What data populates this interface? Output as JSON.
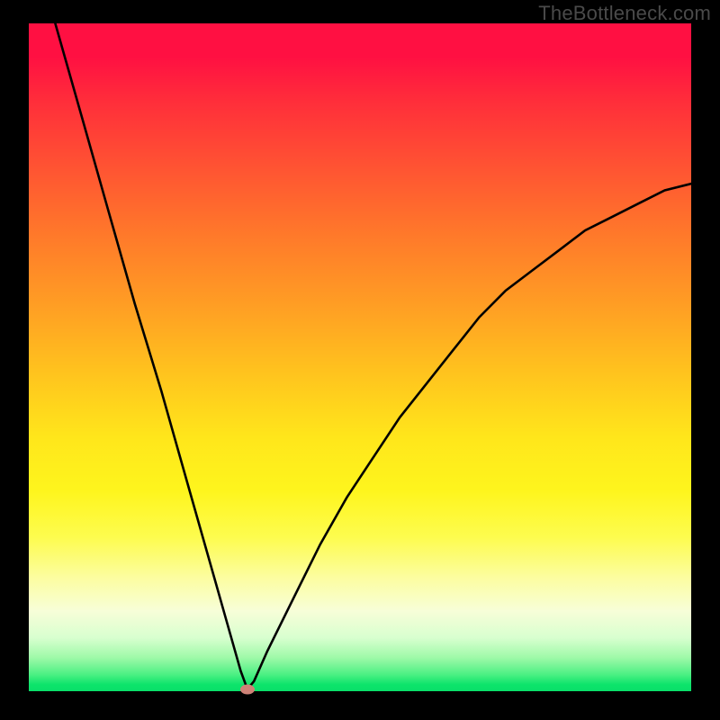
{
  "watermark": "TheBottleneck.com",
  "chart_data": {
    "type": "line",
    "title": "",
    "xlabel": "",
    "ylabel": "",
    "xlim": [
      0,
      100
    ],
    "ylim": [
      0,
      100
    ],
    "grid": false,
    "series": [
      {
        "name": "curve",
        "x": [
          4,
          8,
          12,
          16,
          20,
          24,
          28,
          30,
          32,
          33,
          34,
          36,
          40,
          44,
          48,
          52,
          56,
          60,
          64,
          68,
          72,
          76,
          80,
          84,
          88,
          92,
          96,
          100
        ],
        "y": [
          100,
          86,
          72,
          58,
          45,
          31,
          17,
          10,
          3,
          0.3,
          1.5,
          6,
          14,
          22,
          29,
          35,
          41,
          46,
          51,
          56,
          60,
          63,
          66,
          69,
          71,
          73,
          75,
          76
        ]
      }
    ],
    "marker": {
      "x": 33,
      "y": 0.3,
      "color": "#cf8277"
    },
    "background_gradient": {
      "top": "#ff1042",
      "mid": "#ffe61b",
      "bottom": "#09df69"
    }
  }
}
